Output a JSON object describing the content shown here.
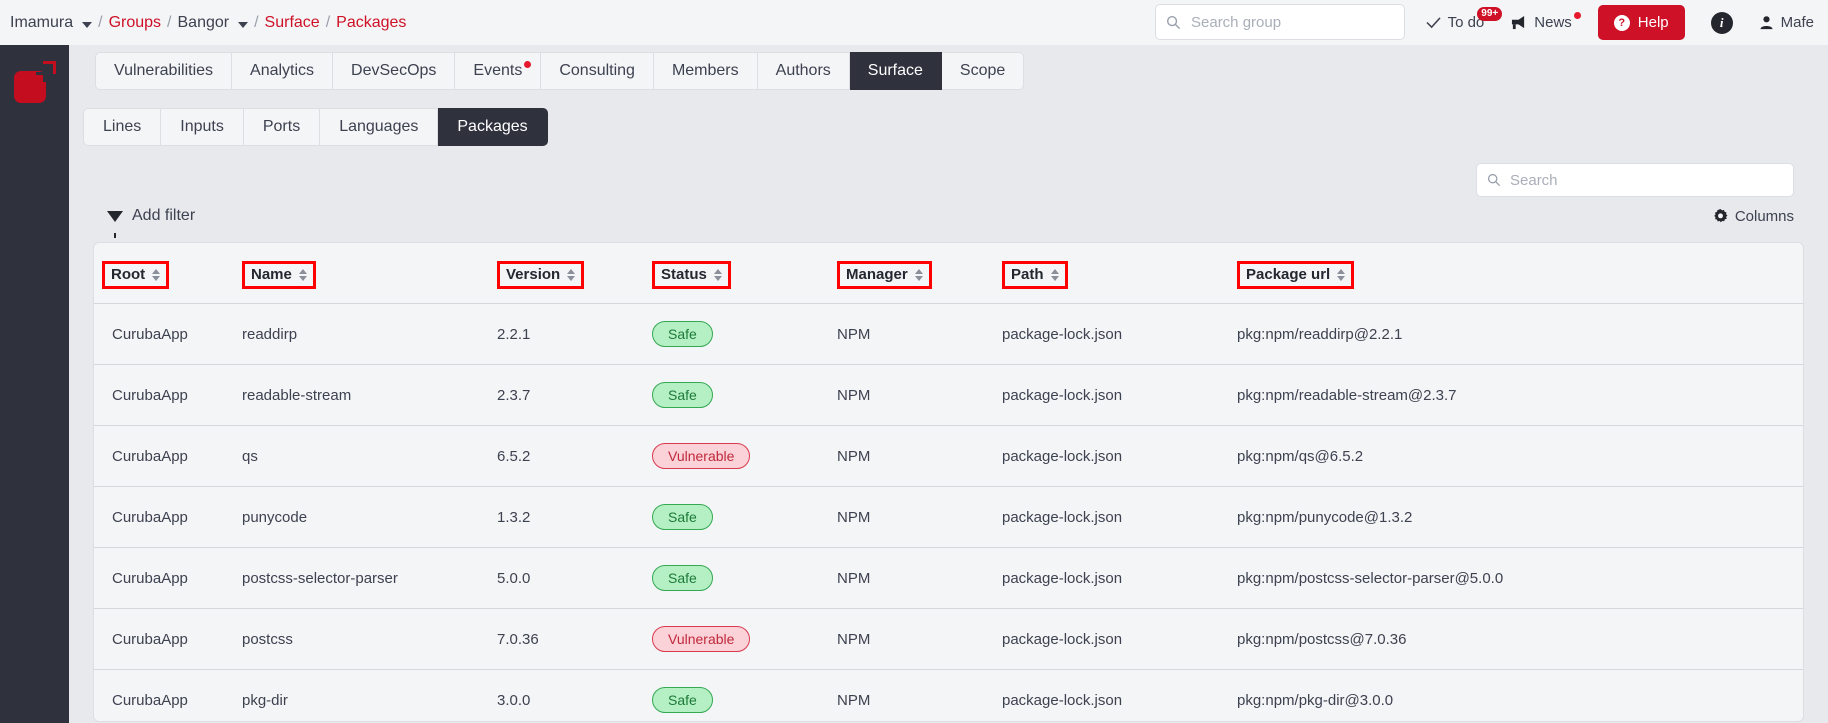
{
  "breadcrumb": {
    "org": "Imamura",
    "groups": "Groups",
    "project": "Bangor",
    "section": "Surface",
    "page": "Packages",
    "sep": "/"
  },
  "header": {
    "group_search_placeholder": "Search group",
    "search_icon": "search-icon",
    "todo_label": "To do",
    "todo_badge": "99+",
    "check_icon": "check-icon",
    "news_label": "News",
    "megaphone_icon": "megaphone-icon",
    "help_label": "Help",
    "help_icon": "question-mark-icon",
    "info_icon": "info-icon",
    "info_glyph": "i",
    "user_label": "Mafe",
    "user_icon": "person-icon",
    "help_color": "#cf1127"
  },
  "sidebar": {
    "logo_name": "app-logo",
    "logo_color": "#c40d1e",
    "bg": "#2f313c"
  },
  "tabs": [
    {
      "label": "Vulnerabilities",
      "active": false,
      "dot": false
    },
    {
      "label": "Analytics",
      "active": false,
      "dot": false
    },
    {
      "label": "DevSecOps",
      "active": false,
      "dot": false
    },
    {
      "label": "Events",
      "active": false,
      "dot": true
    },
    {
      "label": "Consulting",
      "active": false,
      "dot": false
    },
    {
      "label": "Members",
      "active": false,
      "dot": false
    },
    {
      "label": "Authors",
      "active": false,
      "dot": false
    },
    {
      "label": "Surface",
      "active": true,
      "dot": false
    },
    {
      "label": "Scope",
      "active": false,
      "dot": false
    }
  ],
  "subtabs": [
    {
      "label": "Lines",
      "active": false
    },
    {
      "label": "Inputs",
      "active": false
    },
    {
      "label": "Ports",
      "active": false
    },
    {
      "label": "Languages",
      "active": false
    },
    {
      "label": "Packages",
      "active": true
    }
  ],
  "toolbar": {
    "search_placeholder": "Search",
    "search_value": "",
    "add_filter_label": "Add filter",
    "filter_icon": "funnel-icon",
    "columns_label": "Columns",
    "columns_icon": "gear-icon"
  },
  "table": {
    "columns": [
      {
        "label": "Root",
        "sortable": true,
        "highlighted": true
      },
      {
        "label": "Name",
        "sortable": true,
        "highlighted": true
      },
      {
        "label": "Version",
        "sortable": true,
        "highlighted": true
      },
      {
        "label": "Status",
        "sortable": true,
        "highlighted": true
      },
      {
        "label": "Manager",
        "sortable": true,
        "highlighted": true
      },
      {
        "label": "Path",
        "sortable": true,
        "highlighted": true
      },
      {
        "label": "Package url",
        "sortable": true,
        "highlighted": true
      }
    ],
    "rows": [
      {
        "root": "CurubaApp",
        "name": "readdirp",
        "version": "2.2.1",
        "status": "Safe",
        "status_kind": "safe",
        "manager": "NPM",
        "path": "package-lock.json",
        "url": "pkg:npm/readdirp@2.2.1"
      },
      {
        "root": "CurubaApp",
        "name": "readable-stream",
        "version": "2.3.7",
        "status": "Safe",
        "status_kind": "safe",
        "manager": "NPM",
        "path": "package-lock.json",
        "url": "pkg:npm/readable-stream@2.3.7"
      },
      {
        "root": "CurubaApp",
        "name": "qs",
        "version": "6.5.2",
        "status": "Vulnerable",
        "status_kind": "vuln",
        "manager": "NPM",
        "path": "package-lock.json",
        "url": "pkg:npm/qs@6.5.2"
      },
      {
        "root": "CurubaApp",
        "name": "punycode",
        "version": "1.3.2",
        "status": "Safe",
        "status_kind": "safe",
        "manager": "NPM",
        "path": "package-lock.json",
        "url": "pkg:npm/punycode@1.3.2"
      },
      {
        "root": "CurubaApp",
        "name": "postcss-selector-parser",
        "version": "5.0.0",
        "status": "Safe",
        "status_kind": "safe",
        "manager": "NPM",
        "path": "package-lock.json",
        "url": "pkg:npm/postcss-selector-parser@5.0.0"
      },
      {
        "root": "CurubaApp",
        "name": "postcss",
        "version": "7.0.36",
        "status": "Vulnerable",
        "status_kind": "vuln",
        "manager": "NPM",
        "path": "package-lock.json",
        "url": "pkg:npm/postcss@7.0.36"
      },
      {
        "root": "CurubaApp",
        "name": "pkg-dir",
        "version": "3.0.0",
        "status": "Safe",
        "status_kind": "safe",
        "manager": "NPM",
        "path": "package-lock.json",
        "url": "pkg:npm/pkg-dir@3.0.0"
      }
    ]
  },
  "colors": {
    "accent_red": "#cf1127",
    "dark": "#2f313c",
    "safe_bg": "#b4f0c4",
    "safe_border": "#34a853",
    "vuln_bg": "#fbd2d7",
    "vuln_border": "#d93a4e",
    "annotation": "#ff0000"
  }
}
